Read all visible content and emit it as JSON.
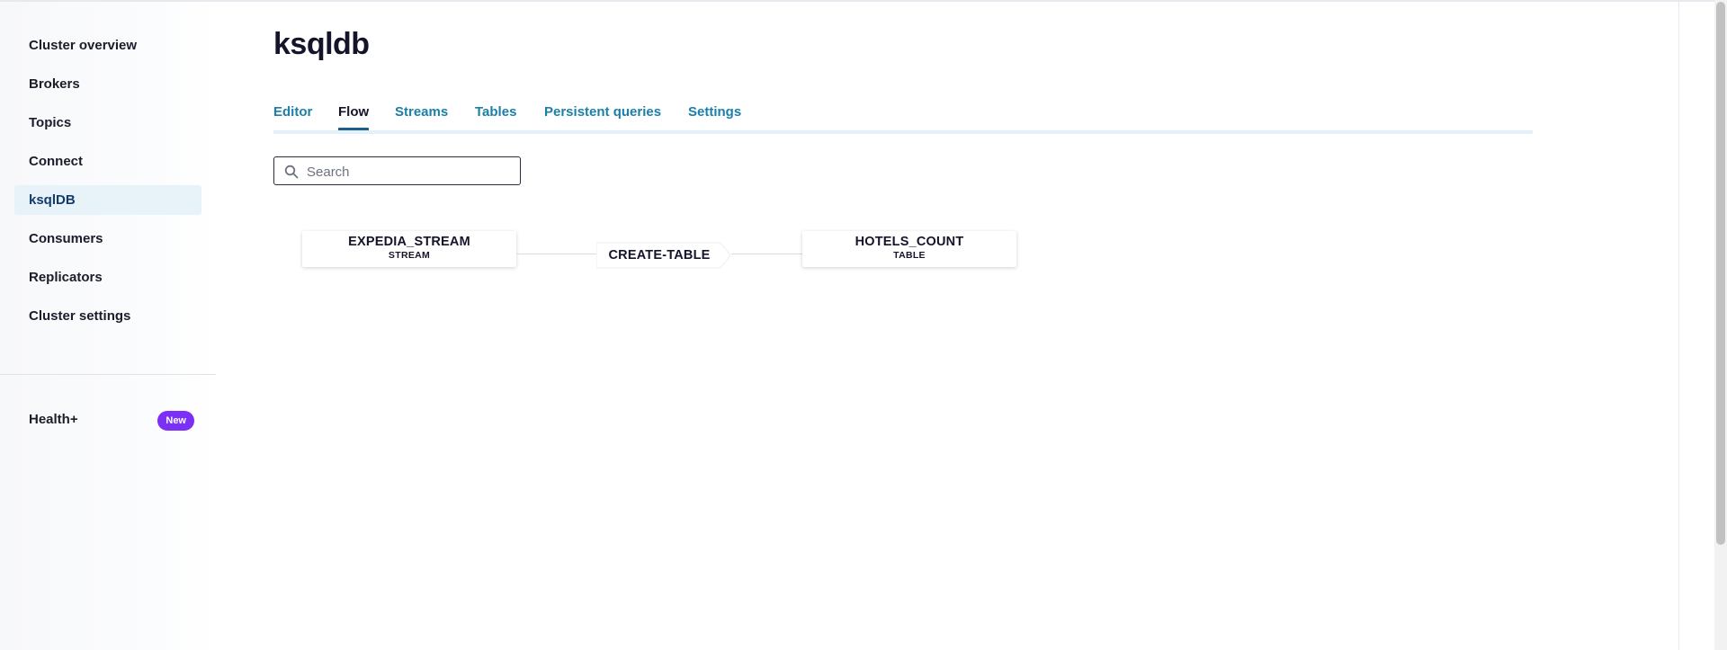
{
  "sidebar": {
    "items": [
      {
        "label": "Cluster overview",
        "active": false
      },
      {
        "label": "Brokers",
        "active": false
      },
      {
        "label": "Topics",
        "active": false
      },
      {
        "label": "Connect",
        "active": false
      },
      {
        "label": "ksqlDB",
        "active": true
      },
      {
        "label": "Consumers",
        "active": false
      },
      {
        "label": "Replicators",
        "active": false
      },
      {
        "label": "Cluster settings",
        "active": false
      }
    ],
    "health": {
      "label": "Health+",
      "badge": "New"
    }
  },
  "page": {
    "title": "ksqldb"
  },
  "tabs": [
    {
      "label": "Editor",
      "active": false
    },
    {
      "label": "Flow",
      "active": true
    },
    {
      "label": "Streams",
      "active": false
    },
    {
      "label": "Tables",
      "active": false
    },
    {
      "label": "Persistent queries",
      "active": false
    },
    {
      "label": "Settings",
      "active": false
    }
  ],
  "search": {
    "placeholder": "Search",
    "value": ""
  },
  "flow": {
    "source": {
      "name": "EXPEDIA_STREAM",
      "type": "STREAM"
    },
    "query": {
      "label": "CREATE-TABLE"
    },
    "sink": {
      "name": "HOTELS_COUNT",
      "type": "TABLE"
    }
  },
  "colors": {
    "accent": "#1b7fa6",
    "active_tab_underline": "#1b5f8a",
    "active_nav_bg": "#e7f2f9",
    "badge": "#7b2ff7"
  }
}
